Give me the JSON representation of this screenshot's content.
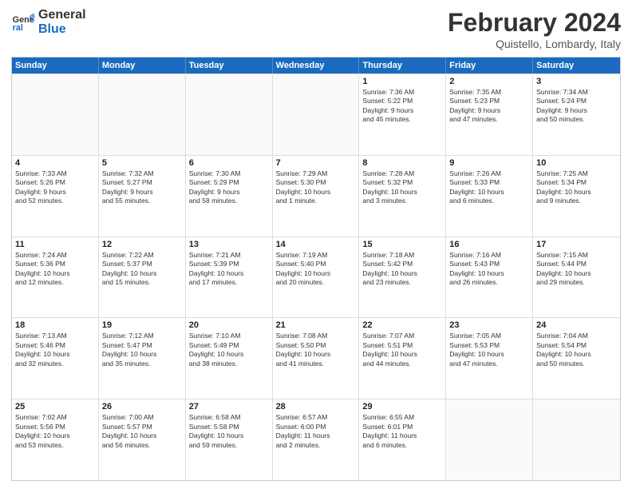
{
  "logo": {
    "line1": "General",
    "line2": "Blue"
  },
  "title": "February 2024",
  "location": "Quistello, Lombardy, Italy",
  "weekdays": [
    "Sunday",
    "Monday",
    "Tuesday",
    "Wednesday",
    "Thursday",
    "Friday",
    "Saturday"
  ],
  "rows": [
    [
      {
        "day": "",
        "info": ""
      },
      {
        "day": "",
        "info": ""
      },
      {
        "day": "",
        "info": ""
      },
      {
        "day": "",
        "info": ""
      },
      {
        "day": "1",
        "info": "Sunrise: 7:36 AM\nSunset: 5:22 PM\nDaylight: 9 hours\nand 45 minutes."
      },
      {
        "day": "2",
        "info": "Sunrise: 7:35 AM\nSunset: 5:23 PM\nDaylight: 9 hours\nand 47 minutes."
      },
      {
        "day": "3",
        "info": "Sunrise: 7:34 AM\nSunset: 5:24 PM\nDaylight: 9 hours\nand 50 minutes."
      }
    ],
    [
      {
        "day": "4",
        "info": "Sunrise: 7:33 AM\nSunset: 5:26 PM\nDaylight: 9 hours\nand 52 minutes."
      },
      {
        "day": "5",
        "info": "Sunrise: 7:32 AM\nSunset: 5:27 PM\nDaylight: 9 hours\nand 55 minutes."
      },
      {
        "day": "6",
        "info": "Sunrise: 7:30 AM\nSunset: 5:29 PM\nDaylight: 9 hours\nand 58 minutes."
      },
      {
        "day": "7",
        "info": "Sunrise: 7:29 AM\nSunset: 5:30 PM\nDaylight: 10 hours\nand 1 minute."
      },
      {
        "day": "8",
        "info": "Sunrise: 7:28 AM\nSunset: 5:32 PM\nDaylight: 10 hours\nand 3 minutes."
      },
      {
        "day": "9",
        "info": "Sunrise: 7:26 AM\nSunset: 5:33 PM\nDaylight: 10 hours\nand 6 minutes."
      },
      {
        "day": "10",
        "info": "Sunrise: 7:25 AM\nSunset: 5:34 PM\nDaylight: 10 hours\nand 9 minutes."
      }
    ],
    [
      {
        "day": "11",
        "info": "Sunrise: 7:24 AM\nSunset: 5:36 PM\nDaylight: 10 hours\nand 12 minutes."
      },
      {
        "day": "12",
        "info": "Sunrise: 7:22 AM\nSunset: 5:37 PM\nDaylight: 10 hours\nand 15 minutes."
      },
      {
        "day": "13",
        "info": "Sunrise: 7:21 AM\nSunset: 5:39 PM\nDaylight: 10 hours\nand 17 minutes."
      },
      {
        "day": "14",
        "info": "Sunrise: 7:19 AM\nSunset: 5:40 PM\nDaylight: 10 hours\nand 20 minutes."
      },
      {
        "day": "15",
        "info": "Sunrise: 7:18 AM\nSunset: 5:42 PM\nDaylight: 10 hours\nand 23 minutes."
      },
      {
        "day": "16",
        "info": "Sunrise: 7:16 AM\nSunset: 5:43 PM\nDaylight: 10 hours\nand 26 minutes."
      },
      {
        "day": "17",
        "info": "Sunrise: 7:15 AM\nSunset: 5:44 PM\nDaylight: 10 hours\nand 29 minutes."
      }
    ],
    [
      {
        "day": "18",
        "info": "Sunrise: 7:13 AM\nSunset: 5:46 PM\nDaylight: 10 hours\nand 32 minutes."
      },
      {
        "day": "19",
        "info": "Sunrise: 7:12 AM\nSunset: 5:47 PM\nDaylight: 10 hours\nand 35 minutes."
      },
      {
        "day": "20",
        "info": "Sunrise: 7:10 AM\nSunset: 5:49 PM\nDaylight: 10 hours\nand 38 minutes."
      },
      {
        "day": "21",
        "info": "Sunrise: 7:08 AM\nSunset: 5:50 PM\nDaylight: 10 hours\nand 41 minutes."
      },
      {
        "day": "22",
        "info": "Sunrise: 7:07 AM\nSunset: 5:51 PM\nDaylight: 10 hours\nand 44 minutes."
      },
      {
        "day": "23",
        "info": "Sunrise: 7:05 AM\nSunset: 5:53 PM\nDaylight: 10 hours\nand 47 minutes."
      },
      {
        "day": "24",
        "info": "Sunrise: 7:04 AM\nSunset: 5:54 PM\nDaylight: 10 hours\nand 50 minutes."
      }
    ],
    [
      {
        "day": "25",
        "info": "Sunrise: 7:02 AM\nSunset: 5:56 PM\nDaylight: 10 hours\nand 53 minutes."
      },
      {
        "day": "26",
        "info": "Sunrise: 7:00 AM\nSunset: 5:57 PM\nDaylight: 10 hours\nand 56 minutes."
      },
      {
        "day": "27",
        "info": "Sunrise: 6:58 AM\nSunset: 5:58 PM\nDaylight: 10 hours\nand 59 minutes."
      },
      {
        "day": "28",
        "info": "Sunrise: 6:57 AM\nSunset: 6:00 PM\nDaylight: 11 hours\nand 2 minutes."
      },
      {
        "day": "29",
        "info": "Sunrise: 6:55 AM\nSunset: 6:01 PM\nDaylight: 11 hours\nand 6 minutes."
      },
      {
        "day": "",
        "info": ""
      },
      {
        "day": "",
        "info": ""
      }
    ]
  ]
}
